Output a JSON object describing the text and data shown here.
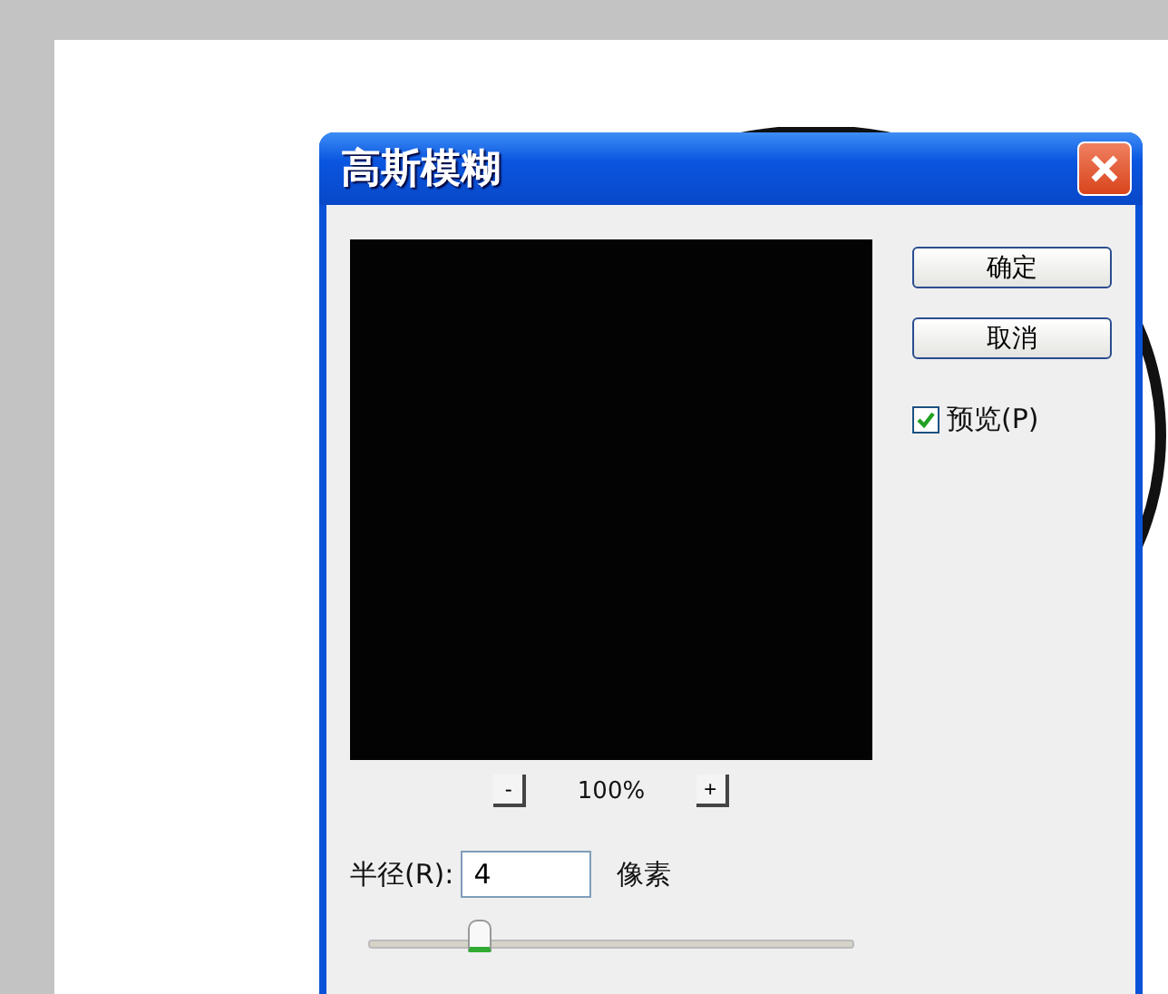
{
  "dialog": {
    "title": "高斯模糊"
  },
  "buttons": [
    "确定",
    "取消"
  ],
  "preview_checkbox": {
    "label": "预览(P)",
    "checked": true
  },
  "zoom": {
    "minus": "-",
    "value": "100%",
    "plus": "+"
  },
  "radius": {
    "label": "半径(R):",
    "value": "4",
    "unit": "像素"
  },
  "slider": {
    "level": 0.22
  }
}
